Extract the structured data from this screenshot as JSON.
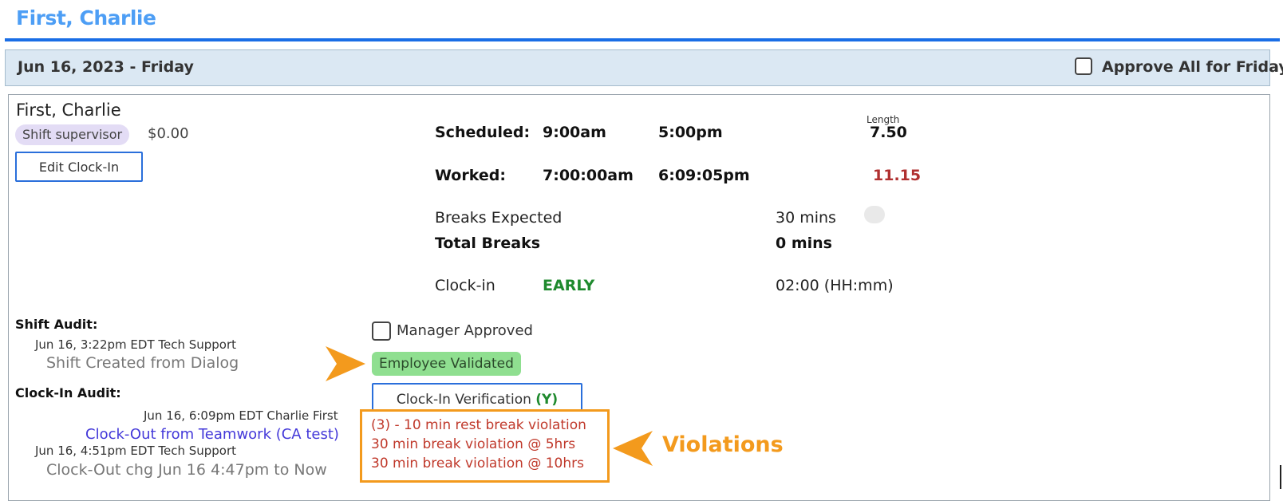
{
  "header": {
    "employee_title": "First, Charlie"
  },
  "day_bar": {
    "date_label": "Jun 16, 2023 - Friday",
    "approve_all_label": "Approve All for Friday",
    "approve_all_checked": false
  },
  "shift": {
    "employee_name": "First, Charlie",
    "role": "Shift supervisor",
    "pay": "$0.00",
    "edit_button_label": "Edit Clock-In",
    "length_caption": "Length",
    "scheduled": {
      "label": "Scheduled:",
      "start": "9:00am",
      "end": "5:00pm",
      "length": "7.50"
    },
    "worked": {
      "label": "Worked:",
      "start": "7:00:00am",
      "end": "6:09:05pm",
      "length": "11.15"
    },
    "breaks_expected": {
      "label": "Breaks Expected",
      "value": "30 mins"
    },
    "total_breaks": {
      "label": "Total Breaks",
      "value": "0 mins"
    },
    "clock_in": {
      "label": "Clock-in",
      "status": "EARLY",
      "diff": "02:00 (HH:mm)"
    }
  },
  "shift_audit": {
    "heading": "Shift Audit:",
    "entries": [
      {
        "meta": "Jun 16, 3:22pm EDT Tech Support",
        "message": "Shift Created from Dialog"
      }
    ]
  },
  "clockin_audit": {
    "heading": "Clock-In Audit:",
    "entries": [
      {
        "meta": "Jun 16, 6:09pm EDT Charlie First",
        "message": "Clock-Out from Teamwork (CA test)"
      },
      {
        "meta": "Jun 16, 4:51pm EDT Tech Support",
        "message": "Clock-Out chg Jun 16 4:47pm to Now"
      }
    ]
  },
  "approvals": {
    "manager_approved_label": "Manager Approved",
    "manager_approved_checked": false,
    "employee_validated_label": "Employee Validated",
    "verification_button_label": "Clock-In Verification",
    "verification_flag": "(Y)"
  },
  "violations": {
    "items": [
      "(3) - 10 min rest break violation",
      "30 min break violation @ 5hrs",
      "30 min break violation @ 10hrs"
    ],
    "callout_label": "Violations"
  },
  "colors": {
    "accent": "#1a6ee6",
    "title": "#4d9ef5",
    "callout": "#f39a1d",
    "violation": "#c0392b",
    "success": "#1f8a2e"
  }
}
